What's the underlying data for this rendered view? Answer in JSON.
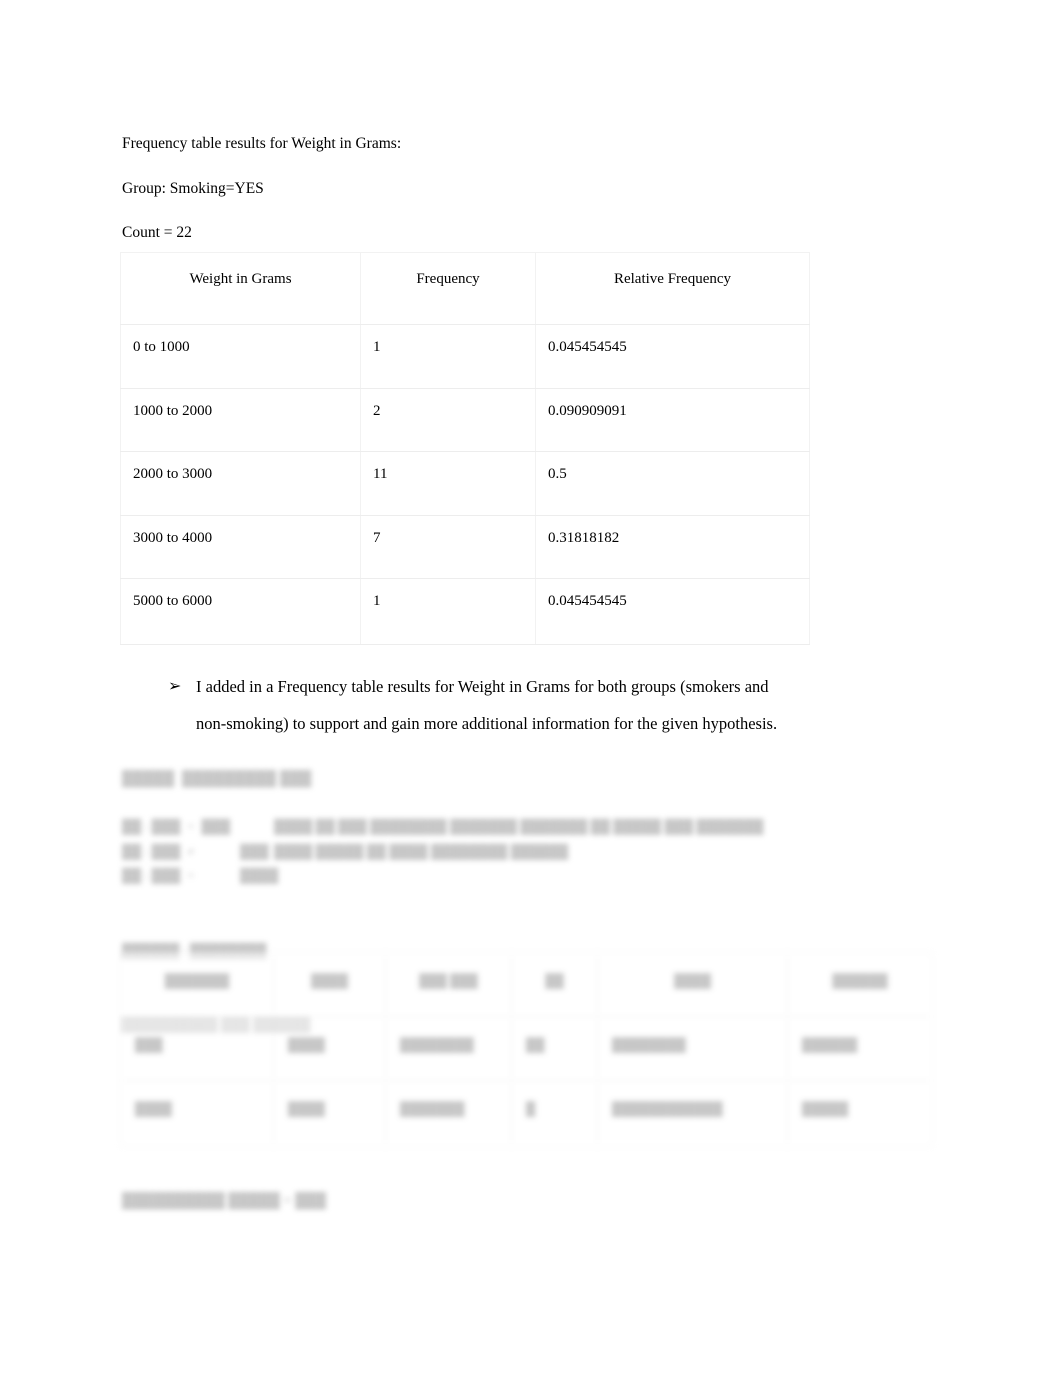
{
  "document": {
    "intro_lines": [
      "Frequency table results for Weight in Grams:",
      "Group: Smoking=YES",
      "Count = 22"
    ]
  },
  "frequency_table": {
    "headers": [
      "Weight in Grams",
      "Frequency",
      "Relative Frequency"
    ],
    "rows": [
      [
        "0 to 1000",
        "1",
        "0.045454545"
      ],
      [
        "1000 to 2000",
        "2",
        "0.090909091"
      ],
      [
        "2000 to 3000",
        "11",
        "0.5"
      ],
      [
        "3000 to 4000",
        "7",
        "0.31818182"
      ],
      [
        "5000 to 6000",
        "1",
        "0.045454545"
      ]
    ]
  },
  "chart_data": {
    "type": "table",
    "title": "Frequency table results for Weight in Grams",
    "subtitle": "Group: Smoking=YES, Count = 22",
    "columns": [
      "Weight in Grams",
      "Frequency",
      "Relative Frequency"
    ],
    "categories": [
      "0 to 1000",
      "1000 to 2000",
      "2000 to 3000",
      "3000 to 4000",
      "5000 to 6000"
    ],
    "series": [
      {
        "name": "Frequency",
        "values": [
          1,
          2,
          11,
          7,
          1
        ]
      },
      {
        "name": "Relative Frequency",
        "values": [
          0.045454545,
          0.090909091,
          0.5,
          0.31818182,
          0.045454545
        ]
      }
    ],
    "total_count": 22,
    "group": "Smoking=YES",
    "xlabel": "Weight in Grams",
    "ylabel": "Frequency",
    "grid": false,
    "legend": "none"
  },
  "bullet": {
    "marker": "arrow-marker",
    "line1": "I added in a Frequency table results for Weight in Grams for both groups (smokers and",
    "line2": "non-smoking) to support and gain more additional information for the given hypothesis."
  },
  "obscured": {
    "note": "region rendered faded/blurred in source screenshot; text not legible",
    "heading": "█████  █████████ ███",
    "hypothesis": [
      {
        "sym": "██ : ███  =  ███",
        "sym2": "",
        "desc": "████ ██ ███ ████████ ███████ ███████ ██ █████ ███ ███████"
      },
      {
        "sym": "██ : ███  ≠",
        "sym2": "███",
        "desc": "████ █████ ██ ████ ████████ ██████"
      },
      {
        "sym": "██ : ███  =",
        "sym2": "████",
        "desc": ""
      }
    ],
    "meta_lines": [
      "██████ : ████████",
      "██████████ ███ ██████"
    ],
    "footer": "██████████ █████ = ███"
  },
  "stat_table": {
    "headers": [
      "███████",
      "████",
      "███ ███",
      "██",
      "████",
      "██████"
    ],
    "rows": [
      [
        "███",
        "████",
        "████████",
        "██",
        "████████",
        "██████"
      ],
      [
        "████",
        "████",
        "███████",
        "█",
        "████████████",
        "█████"
      ]
    ]
  }
}
